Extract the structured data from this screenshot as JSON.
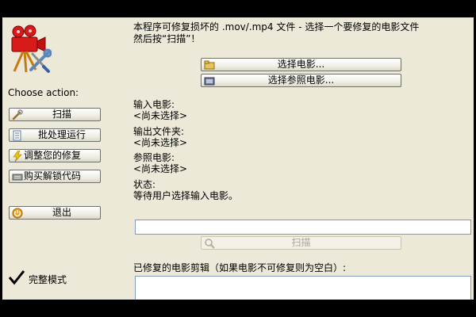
{
  "colors": {
    "window_bg": "#ECE9D8",
    "frame": "#000000",
    "border": "#6F6F6F",
    "field_border": "#7F9DB9",
    "disabled_text": "#A8A596"
  },
  "sidebar": {
    "choose_label": "Choose action:",
    "buttons": [
      {
        "label": "扫描",
        "icon": "wrench-icon"
      },
      {
        "label": "批处理运行",
        "icon": "batch-icon"
      },
      {
        "label": "调整您的修复",
        "icon": "lightning-icon"
      },
      {
        "label": "购买解锁代码",
        "icon": "keyboard-icon"
      },
      {
        "label": "退出",
        "icon": "power-icon"
      }
    ],
    "full_mode_label": "完整模式",
    "logo_icon": "movie-camera-tools-icon"
  },
  "main": {
    "description_line1": "本程序可修复损坏的 .mov/.mp4 文件 - 选择一个要修复的电影文件",
    "description_line2": "然后按“扫描”！",
    "select_movie_button": "选择电影...",
    "select_reference_button": "选择参照电影...",
    "input_movie_label": "输入电影:",
    "input_movie_value": "<尚未选择>",
    "output_folder_label": "输出文件夹:",
    "output_folder_value": "<尚未选择>",
    "reference_movie_label": "参照电影:",
    "reference_movie_value": "<尚未选择>",
    "status_label": "状态:",
    "status_value": "等待用户选择输入电影。",
    "scan_button": "扫描",
    "repaired_clips_label": "已修复的电影剪辑（如果电影不可修复则为空白）:"
  }
}
